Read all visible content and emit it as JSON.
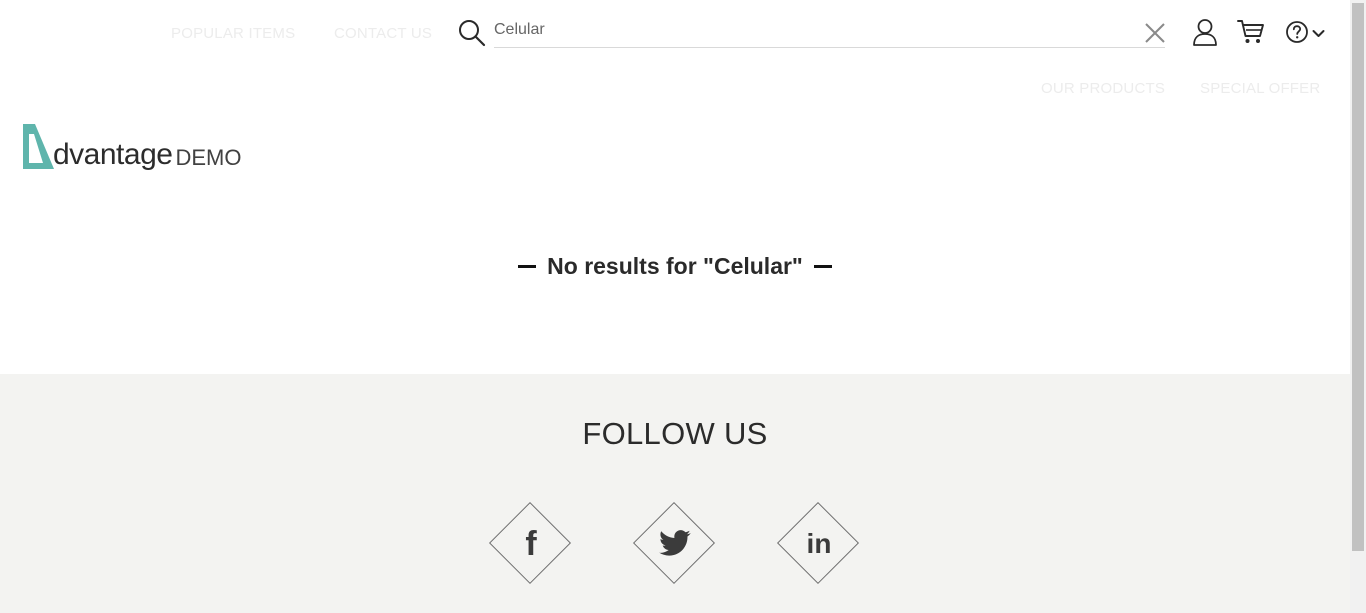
{
  "nav": {
    "popular_items": "POPULAR ITEMS",
    "contact_us": "CONTACT US",
    "our_products": "OUR PRODUCTS",
    "special_offer": "SPECIAL OFFER"
  },
  "search": {
    "value": "Celular"
  },
  "icons": {
    "search": "search-icon",
    "clear": "close-icon",
    "user": "user-icon",
    "cart": "cart-icon",
    "help": "help-icon",
    "dropdown": "chevron-down-icon"
  },
  "logo": {
    "word": "dvantage",
    "demo": "DEMO",
    "brand_color": "#5fb5ac"
  },
  "results": {
    "message": "No results for \"Celular\""
  },
  "footer": {
    "follow_title": "FOLLOW US",
    "social": [
      {
        "name": "facebook",
        "glyph": "f"
      },
      {
        "name": "twitter",
        "glyph": "twitter-bird"
      },
      {
        "name": "linkedin",
        "glyph": "in"
      }
    ]
  }
}
